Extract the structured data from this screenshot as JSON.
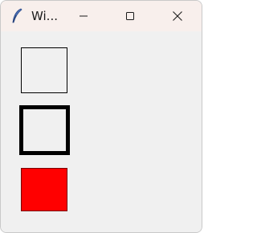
{
  "window": {
    "title": "Wi...",
    "app_icon": "feather-icon",
    "controls": {
      "minimize_icon": "minimize-icon",
      "maximize_icon": "maximize-icon",
      "close_icon": "close-icon"
    }
  },
  "canvas": {
    "background": "#f0f0f0",
    "squares": [
      {
        "name": "thin-outline",
        "border_color": "#000000",
        "fill": "none"
      },
      {
        "name": "thick-outline",
        "border_color": "#000000",
        "fill": "none"
      },
      {
        "name": "filled",
        "border_color": "#7a0000",
        "fill": "#ff0000"
      }
    ]
  },
  "colors": {
    "titlebar": "#f8efec",
    "window_bg": "#f0f0f0",
    "red": "#ff0000"
  }
}
